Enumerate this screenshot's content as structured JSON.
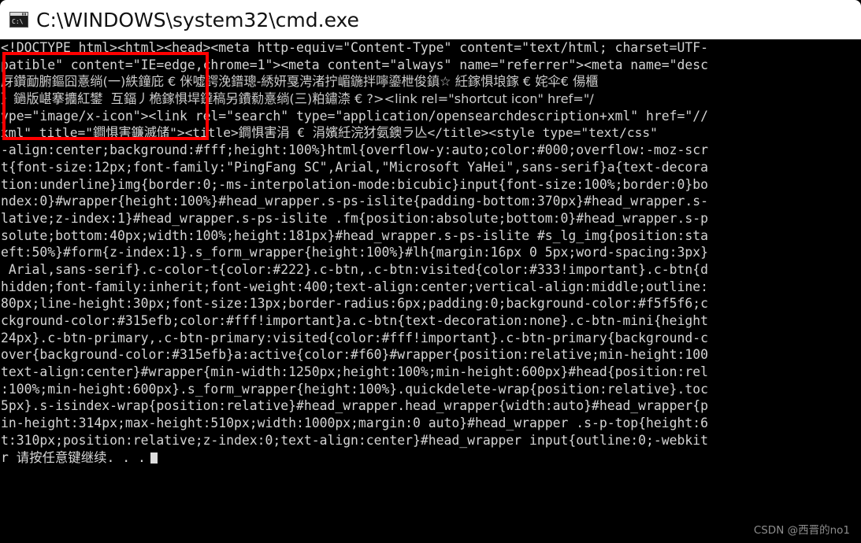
{
  "window": {
    "title": "C:\\WINDOWS\\system32\\cmd.exe",
    "icon": "cmd-console-icon",
    "titlebar_bg": "#ffffff",
    "console_bg": "#000000",
    "console_fg": "#d4d4d4"
  },
  "annotation": {
    "color": "#ff0000",
    "shape": "rectangle",
    "count": 1
  },
  "console": {
    "lines": [
      "<!DOCTYPE html><html><head><meta http-equiv=\"Content-Type\" content=\"text/html; charset=UTF-",
      "patible\" content=\"IE=edge,chrome=1\"><meta content=\"always\" name=\"referrer\"><meta name=\"desc",
      "厊鑽勔腑鏂囧憙绱(一)紩鐘庇 € 侎噓鍔浼鐠璁-綉妍戛涄渚拧嵋鍦拌嚀鎏枻俊鎮☆ 紝鎵惧埌鎵 € 姹伞€ 偒櫃",
      "〉鐹版嵁搴攟紅鐢  互鍢丿桅鎵惧垾鐽稿另鐨勬憙绱(三)粕鏽渿 € ?><link rel=\"shortcut icon\" href=\"/",
      "ype=\"image/x-icon\"><link rel=\"search\" type=\"application/opensearchdescription+xml\" href=\"//",
      "xml\" title=\"鐧惧害鐮滅储\"><title>鐧惧害涓 € 涓嬪紝浣犲氨鐭ラ亾</title><style type=\"text/css\"",
      "-align:center;background:#fff;height:100%}html{overflow-y:auto;color:#000;overflow:-moz-scr",
      "t{font-size:12px;font-family:\"PingFang SC\",Arial,\"Microsoft YaHei\",sans-serif}a{text-decora",
      "tion:underline}img{border:0;-ms-interpolation-mode:bicubic}input{font-size:100%;border:0}bo",
      "ndex:0}#wrapper{height:100%}#head_wrapper.s-ps-islite{padding-bottom:370px}#head_wrapper.s-",
      "lative;z-index:1}#head_wrapper.s-ps-islite .fm{position:absolute;bottom:0}#head_wrapper.s-p",
      "solute;bottom:40px;width:100%;height:181px}#head_wrapper.s-ps-islite #s_lg_img{position:sta",
      "eft:50%}#form{z-index:1}.s_form_wrapper{height:100%}#lh{margin:16px 0 5px;word-spacing:3px}",
      " Arial,sans-serif}.c-color-t{color:#222}.c-btn,.c-btn:visited{color:#333!important}.c-btn{d",
      "hidden;font-family:inherit;font-weight:400;text-align:center;vertical-align:middle;outline:",
      "80px;line-height:30px;font-size:13px;border-radius:6px;padding:0;background-color:#f5f5f6;c",
      "ckground-color:#315efb;color:#fff!important}a.c-btn{text-decoration:none}.c-btn-mini{height",
      "24px}.c-btn-primary,.c-btn-primary:visited{color:#fff!important}.c-btn-primary{background-c",
      "over{background-color:#315efb}a:active{color:#f60}#wrapper{position:relative;min-height:100",
      "text-align:center}#wrapper{min-width:1250px;height:100%;min-height:600px}#head{position:rel",
      ":100%;min-height:600px}.s_form_wrapper{height:100%}.quickdelete-wrap{position:relative}.toc",
      "5px}.s-isindex-wrap{position:relative}#head_wrapper.head_wrapper{width:auto}#head_wrapper{p",
      "in-height:314px;max-height:510px;width:1000px;margin:0 auto}#head_wrapper .s-p-top{height:6",
      "t:310px;position:relative;z-index:0;text-align:center}#head_wrapper input{outline:0;-webkit"
    ],
    "prompt": "r 请按任意键继续. . .",
    "cursor": "block-cursor"
  },
  "watermark": {
    "text": "CSDN @西晋的no1"
  }
}
